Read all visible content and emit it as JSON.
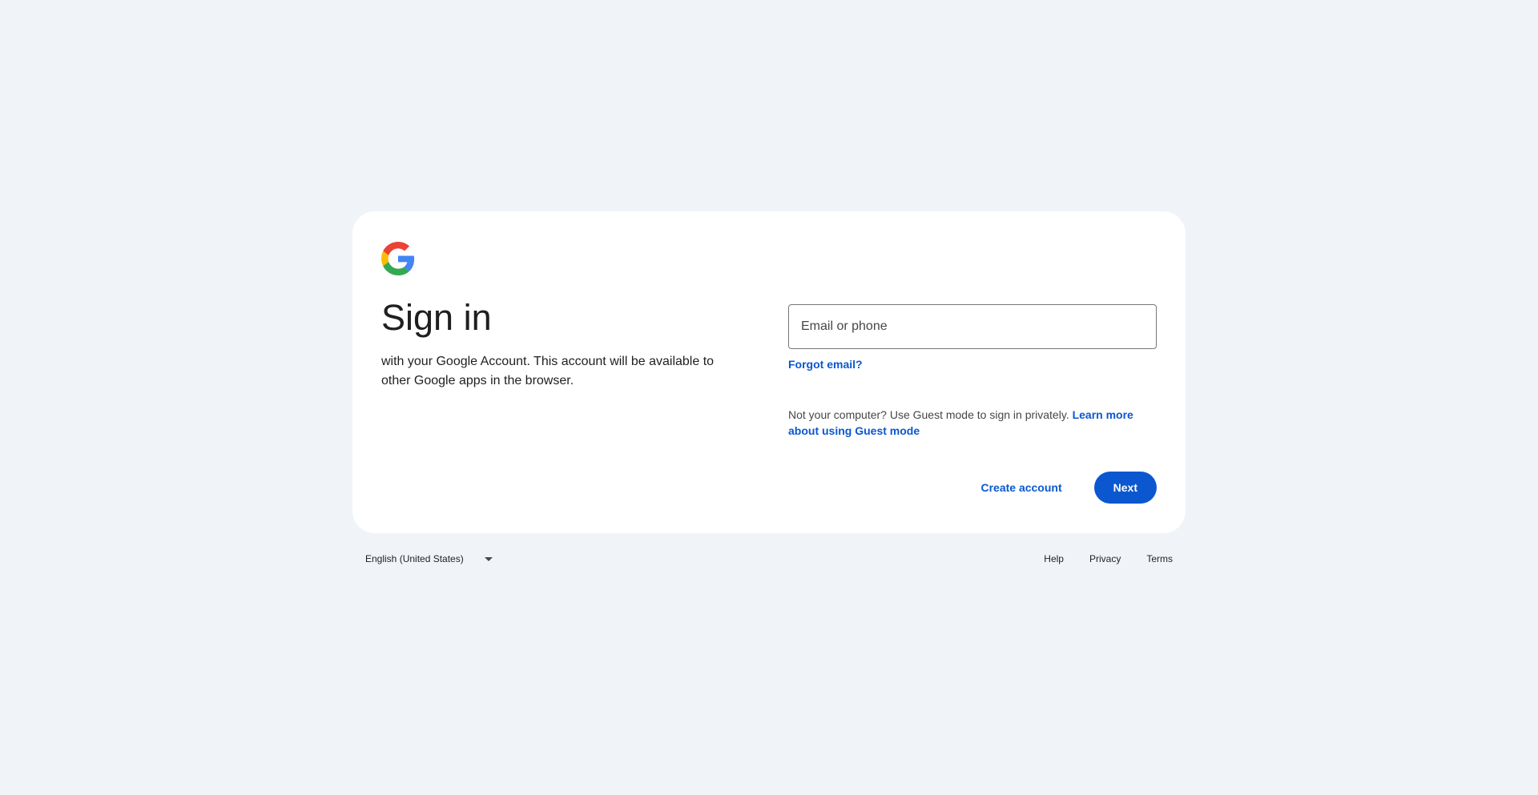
{
  "logo": {
    "icon": "google-g-icon"
  },
  "heading": {
    "title": "Sign in",
    "subtitle": "with your Google Account. This account will be available to other Google apps in the browser."
  },
  "form": {
    "email_placeholder": "Email or phone",
    "email_value": "",
    "forgot_email": "Forgot email?"
  },
  "guest": {
    "text": "Not your computer? Use Guest mode to sign in privately. ",
    "link": "Learn more about using Guest mode"
  },
  "actions": {
    "create_account": "Create account",
    "next": "Next"
  },
  "footer": {
    "language": "English (United States)",
    "links": [
      "Help",
      "Privacy",
      "Terms"
    ]
  },
  "colors": {
    "background": "#f0f4f9",
    "card": "#ffffff",
    "accent": "#0b57d0",
    "text": "#1f1f1f"
  }
}
